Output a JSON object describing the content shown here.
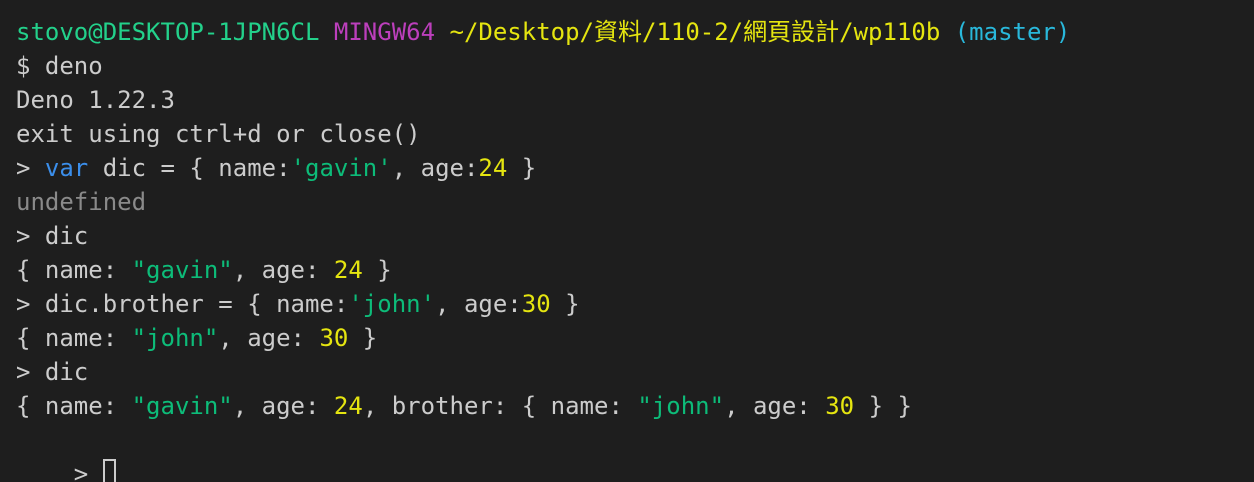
{
  "colors": {
    "background": "#1e1e1e",
    "default": "#cccccc",
    "user_host": "#23d18b",
    "mingw": "#bc3fbc",
    "path": "#e5e510",
    "branch": "#29b8db",
    "keyword": "#3b8eea",
    "string": "#0dbc79",
    "number": "#e5e510",
    "dim": "#8a8a8a"
  },
  "terminal": {
    "lines": [
      [
        {
          "text": "stovo@DESKTOP-1JPN6CL",
          "color": "user_host"
        },
        {
          "text": " ",
          "color": "default"
        },
        {
          "text": "MINGW64",
          "color": "mingw"
        },
        {
          "text": " ",
          "color": "default"
        },
        {
          "text": "~/Desktop/資料/110-2/網頁設計/wp110b",
          "color": "path"
        },
        {
          "text": " ",
          "color": "default"
        },
        {
          "text": "(master)",
          "color": "branch"
        }
      ],
      [
        {
          "text": "$ deno",
          "color": "default"
        }
      ],
      [
        {
          "text": "Deno 1.22.3",
          "color": "default"
        }
      ],
      [
        {
          "text": "exit using ctrl+d or close()",
          "color": "default"
        }
      ],
      [
        {
          "text": "> ",
          "color": "default"
        },
        {
          "text": "var",
          "color": "keyword"
        },
        {
          "text": " dic = { name:",
          "color": "default"
        },
        {
          "text": "'gavin'",
          "color": "string"
        },
        {
          "text": ", age:",
          "color": "default"
        },
        {
          "text": "24",
          "color": "number"
        },
        {
          "text": " }",
          "color": "default"
        }
      ],
      [
        {
          "text": "undefined",
          "color": "dim"
        }
      ],
      [
        {
          "text": "> dic",
          "color": "default"
        }
      ],
      [
        {
          "text": "{ name: ",
          "color": "default"
        },
        {
          "text": "\"gavin\"",
          "color": "string"
        },
        {
          "text": ", age: ",
          "color": "default"
        },
        {
          "text": "24",
          "color": "number"
        },
        {
          "text": " }",
          "color": "default"
        }
      ],
      [
        {
          "text": "> dic.brother = { name:",
          "color": "default"
        },
        {
          "text": "'john'",
          "color": "string"
        },
        {
          "text": ", age:",
          "color": "default"
        },
        {
          "text": "30",
          "color": "number"
        },
        {
          "text": " }",
          "color": "default"
        }
      ],
      [
        {
          "text": "{ name: ",
          "color": "default"
        },
        {
          "text": "\"john\"",
          "color": "string"
        },
        {
          "text": ", age: ",
          "color": "default"
        },
        {
          "text": "30",
          "color": "number"
        },
        {
          "text": " }",
          "color": "default"
        }
      ],
      [
        {
          "text": "> dic",
          "color": "default"
        }
      ],
      [
        {
          "text": "{ name: ",
          "color": "default"
        },
        {
          "text": "\"gavin\"",
          "color": "string"
        },
        {
          "text": ", age: ",
          "color": "default"
        },
        {
          "text": "24",
          "color": "number"
        },
        {
          "text": ", brother: { name: ",
          "color": "default"
        },
        {
          "text": "\"john\"",
          "color": "string"
        },
        {
          "text": ", age: ",
          "color": "default"
        },
        {
          "text": "30",
          "color": "number"
        },
        {
          "text": " } }",
          "color": "default"
        }
      ]
    ],
    "prompt": "> "
  }
}
